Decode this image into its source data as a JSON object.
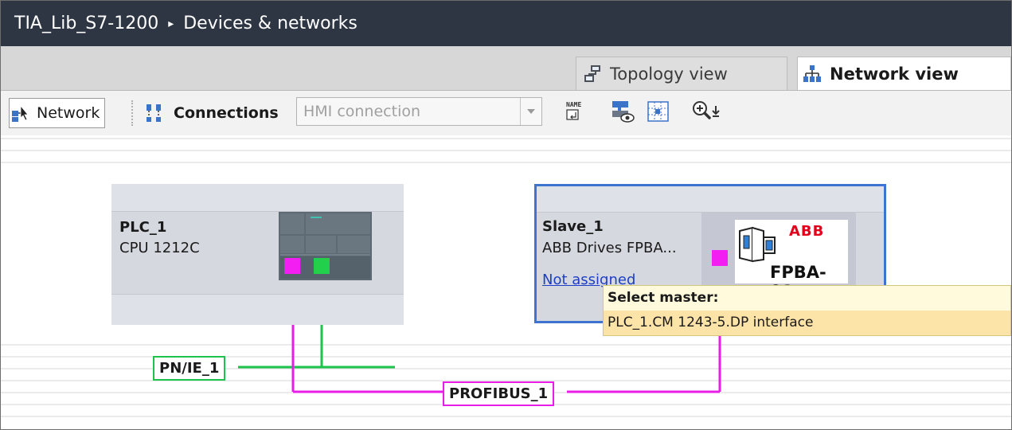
{
  "titlebar": {
    "project": "TIA_Lib_S7-1200",
    "separator": "▸",
    "page": "Devices & networks"
  },
  "tabs": [
    {
      "label": "Topology view",
      "icon": "topology-icon",
      "active": false
    },
    {
      "label": "Network view",
      "icon": "network-tree-icon",
      "active": true
    }
  ],
  "toolbar": {
    "network_label": "Network",
    "connections_label": "Connections",
    "connection_type": {
      "value": "HMI connection",
      "enabled": false
    },
    "icons": [
      "show-names-icon",
      "show-address-icon",
      "grid-icon",
      "zoom-icon"
    ]
  },
  "devices": {
    "plc": {
      "name": "PLC_1",
      "type": "CPU 1212C"
    },
    "slave": {
      "name": "Slave_1",
      "type": "ABB Drives FPBA...",
      "status_link": "Not assigned",
      "module_brand": "ABB",
      "module_label": "FPBA-01"
    }
  },
  "tooltip": {
    "title": "Select master:",
    "option": "PLC_1.CM 1243-5.DP interface"
  },
  "networks": {
    "pn": {
      "label": "PN/IE_1",
      "color": "#1cc44b"
    },
    "profibus": {
      "label": "PROFIBUS_1",
      "color": "#e81ee8"
    }
  },
  "colors": {
    "titlebar_bg": "#2e3644",
    "selection_border": "#3f73d1",
    "tooltip_bg": "#fffadc",
    "tooltip_highlight": "#fce3a8",
    "link": "#1d3fc4"
  }
}
